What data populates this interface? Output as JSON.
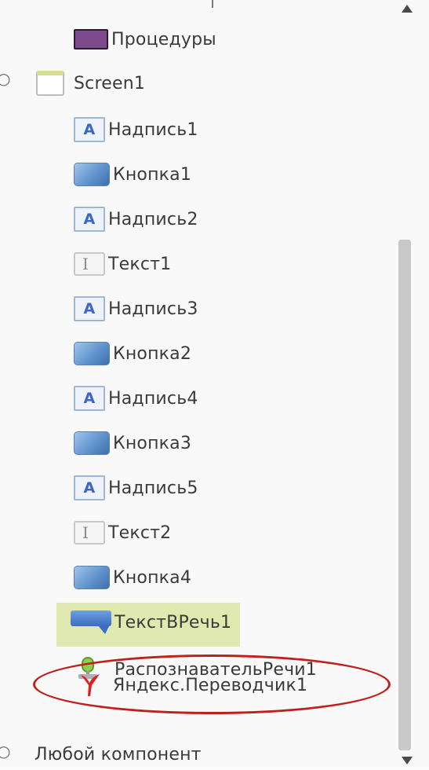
{
  "tree": {
    "procedures": "Процедуры",
    "screen": "Screen1",
    "items": [
      {
        "label": "Надпись1",
        "icon": "label-icon"
      },
      {
        "label": "Кнопка1",
        "icon": "button-icon"
      },
      {
        "label": "Надпись2",
        "icon": "label-icon"
      },
      {
        "label": "Текст1",
        "icon": "textbox-icon"
      },
      {
        "label": "Надпись3",
        "icon": "label-icon"
      },
      {
        "label": "Кнопка2",
        "icon": "button-icon"
      },
      {
        "label": "Надпись4",
        "icon": "label-icon"
      },
      {
        "label": "Кнопка3",
        "icon": "button-icon"
      },
      {
        "label": "Надпись5",
        "icon": "label-icon"
      },
      {
        "label": "Текст2",
        "icon": "textbox-icon"
      },
      {
        "label": "Кнопка4",
        "icon": "button-icon"
      },
      {
        "label": "ТекстВРечь1",
        "icon": "text-to-speech-icon"
      },
      {
        "label": "РаспознавательРечи1",
        "icon": "speech-recognizer-icon"
      },
      {
        "label": "Яндекс.Переводчик1",
        "icon": "yandex-translate-icon"
      }
    ],
    "any_component": "Любой компонент"
  },
  "icon_labels": {
    "label_glyph": "A",
    "textbox_glyph": "I"
  },
  "colors": {
    "selected_row": "#dfe9b0",
    "highlight_oval": "#c0201c",
    "yandex_red": "#e01e1e"
  }
}
